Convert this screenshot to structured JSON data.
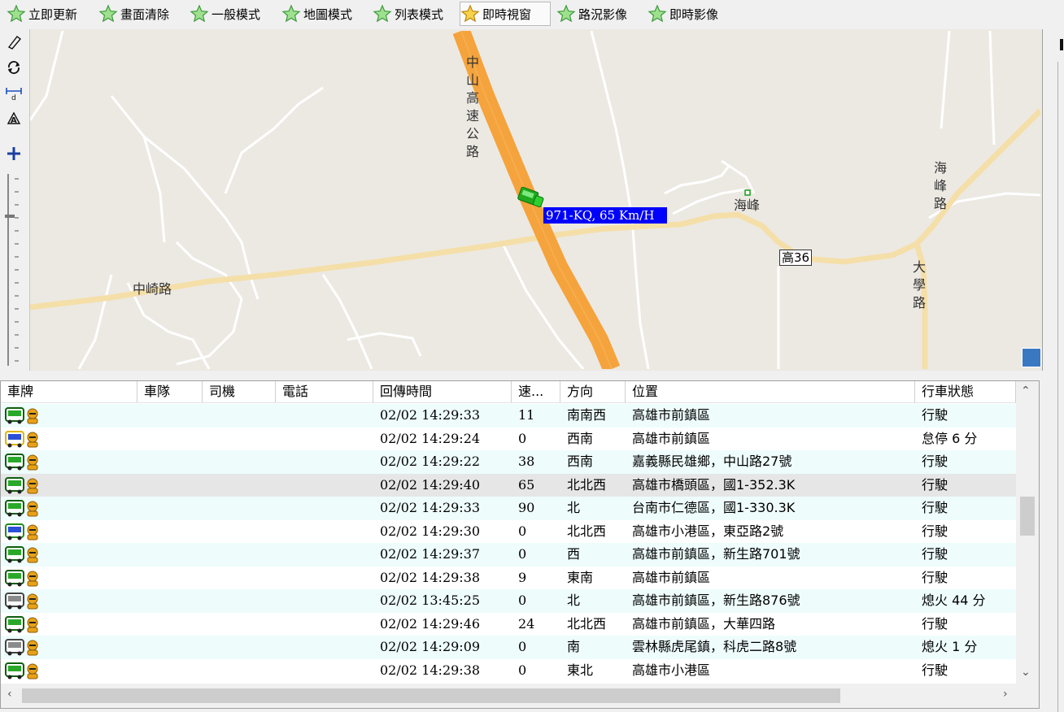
{
  "toolbar": {
    "buttons": [
      {
        "label": "立即更新"
      },
      {
        "label": "畫面清除"
      },
      {
        "label": "一般模式"
      },
      {
        "label": "地圖模式"
      },
      {
        "label": "列表模式"
      },
      {
        "label": "即時視窗"
      },
      {
        "label": "路況影像"
      },
      {
        "label": "即時影像"
      }
    ],
    "active_index": 5
  },
  "map": {
    "labels": {
      "highway": "中山高速公路",
      "road_left": "中崎路",
      "place": "海峰",
      "road_right": "海峰路",
      "road_university": "大學路",
      "route_shield": "高36"
    },
    "vehicle_label": "971-KQ, 65 Km/H",
    "colors": {
      "highway": "#f5a33c",
      "road": "#f5dfa8",
      "background": "#ece9e3",
      "vehicle": "#1faa1f",
      "label_bg": "#0000ff"
    }
  },
  "table": {
    "columns": [
      "車牌",
      "車隊",
      "司機",
      "電話",
      "回傳時間",
      "速...",
      "方向",
      "位置",
      "行車狀態"
    ],
    "rows": [
      {
        "icon": "green-truck-icon",
        "time": "02/02 14:29:33",
        "speed": "11",
        "dir": "南南西",
        "loc": "高雄市前鎮區",
        "status": "行駛"
      },
      {
        "icon": "blue-yellow-truck-icon",
        "time": "02/02 14:29:24",
        "speed": "0",
        "dir": "西南",
        "loc": "高雄市前鎮區",
        "status": "怠停 6 分"
      },
      {
        "icon": "green-truck-icon",
        "time": "02/02 14:29:22",
        "speed": "38",
        "dir": "西南",
        "loc": "嘉義縣民雄鄉，中山路27號",
        "status": "行駛"
      },
      {
        "icon": "green-truck-icon",
        "time": "02/02 14:29:40",
        "speed": "65",
        "dir": "北北西",
        "loc": "高雄市橋頭區，國1-352.3K",
        "status": "行駛"
      },
      {
        "icon": "green-truck-icon",
        "time": "02/02 14:29:33",
        "speed": "90",
        "dir": "北",
        "loc": "台南市仁德區，國1-330.3K",
        "status": "行駛"
      },
      {
        "icon": "blue-green-truck-icon",
        "time": "02/02 14:29:30",
        "speed": "0",
        "dir": "北北西",
        "loc": "高雄市小港區，東亞路2號",
        "status": "行駛"
      },
      {
        "icon": "green-truck-icon",
        "time": "02/02 14:29:37",
        "speed": "0",
        "dir": "西",
        "loc": "高雄市前鎮區，新生路701號",
        "status": "行駛"
      },
      {
        "icon": "green-truck-icon",
        "time": "02/02 14:29:38",
        "speed": "9",
        "dir": "東南",
        "loc": "高雄市前鎮區",
        "status": "行駛"
      },
      {
        "icon": "gray-truck-icon",
        "time": "02/02 13:45:25",
        "speed": "0",
        "dir": "北",
        "loc": "高雄市前鎮區，新生路876號",
        "status": "熄火 44 分"
      },
      {
        "icon": "green-truck-icon",
        "time": "02/02 14:29:46",
        "speed": "24",
        "dir": "北北西",
        "loc": "高雄市前鎮區，大華四路",
        "status": "行駛"
      },
      {
        "icon": "gray-truck-icon",
        "time": "02/02 14:29:09",
        "speed": "0",
        "dir": "南",
        "loc": "雲林縣虎尾鎮，科虎二路8號",
        "status": "熄火 1 分"
      },
      {
        "icon": "green-truck-icon",
        "time": "02/02 14:29:38",
        "speed": "0",
        "dir": "東北",
        "loc": "高雄市小港區",
        "status": "行駛"
      }
    ],
    "selected_row": 3
  }
}
